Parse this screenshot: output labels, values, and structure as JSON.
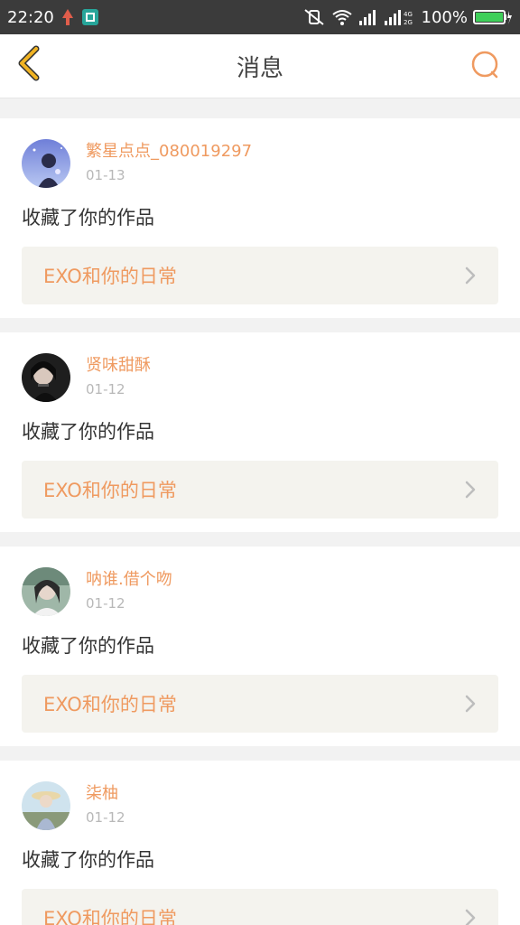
{
  "status_bar": {
    "time": "22:20",
    "battery": "100%",
    "network_label": "4G 2G"
  },
  "header": {
    "title": "消息",
    "back_icon": "chevron-left-icon",
    "search_icon": "search-icon"
  },
  "colors": {
    "accent": "#ef9a60",
    "back_icon": "#f0b323",
    "card_link_bg": "#f4f3ee"
  },
  "messages": [
    {
      "username": "繁星点点_080019297",
      "date": "01-13",
      "action": "收藏了你的作品",
      "work_title": "EXO和你的日常"
    },
    {
      "username": "贤味甜酥",
      "date": "01-12",
      "action": "收藏了你的作品",
      "work_title": "EXO和你的日常"
    },
    {
      "username": "呐谁.借个吻",
      "date": "01-12",
      "action": "收藏了你的作品",
      "work_title": "EXO和你的日常"
    },
    {
      "username": "柒柚",
      "date": "01-12",
      "action": "收藏了你的作品",
      "work_title": "EXO和你的日常"
    }
  ]
}
